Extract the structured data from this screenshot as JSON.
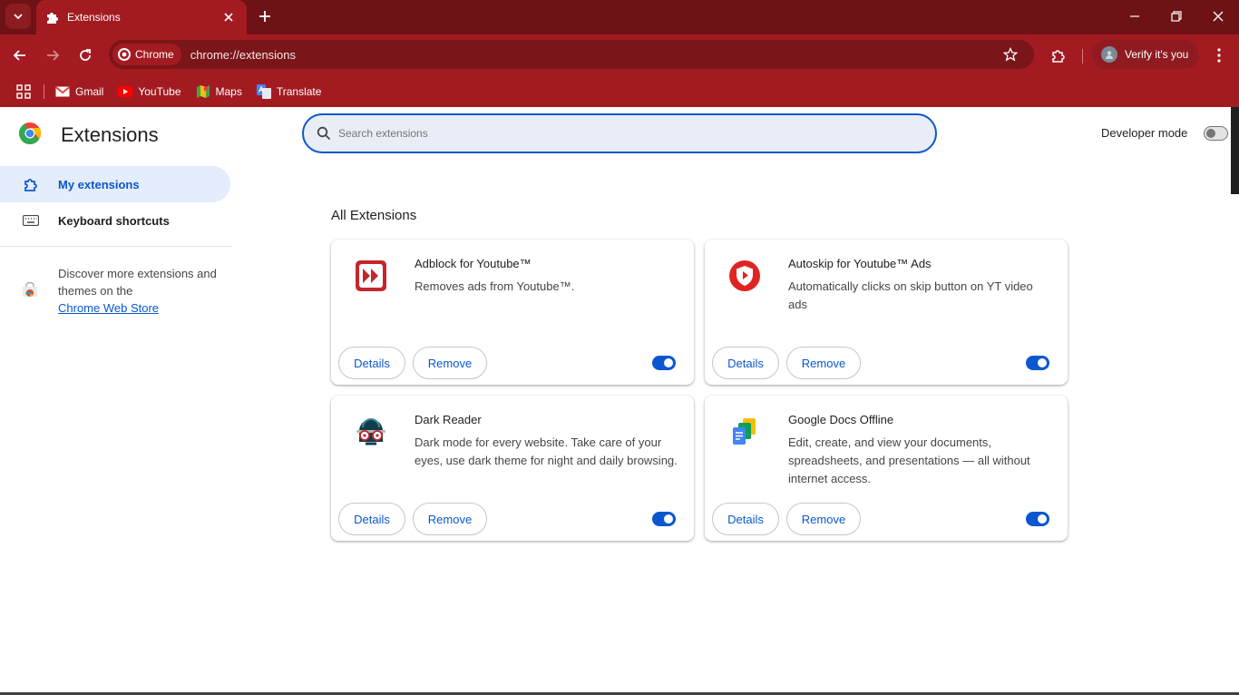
{
  "browser": {
    "tab": {
      "title": "Extensions"
    },
    "address": {
      "chip_label": "Chrome",
      "url": "chrome://extensions"
    },
    "profile": {
      "label": "Verify it's you"
    },
    "bookmarks": [
      {
        "label": "Gmail",
        "icon": "gmail-icon"
      },
      {
        "label": "YouTube",
        "icon": "youtube-icon"
      },
      {
        "label": "Maps",
        "icon": "maps-icon"
      },
      {
        "label": "Translate",
        "icon": "translate-icon"
      }
    ]
  },
  "page": {
    "title": "Extensions",
    "search": {
      "placeholder": "Search extensions",
      "value": ""
    },
    "developer_mode": {
      "label": "Developer mode",
      "enabled": false
    }
  },
  "sidebar": {
    "items": [
      {
        "label": "My extensions",
        "active": true,
        "icon": "puzzle-icon"
      },
      {
        "label": "Keyboard shortcuts",
        "active": false,
        "icon": "keyboard-icon"
      }
    ],
    "store": {
      "text": "Discover more extensions and themes on the",
      "link": "Chrome Web Store"
    }
  },
  "extensions": {
    "section_title": "All Extensions",
    "details_label": "Details",
    "remove_label": "Remove",
    "items": [
      {
        "name": "Adblock for Youtube™",
        "description": "Removes ads from Youtube™.",
        "enabled": true,
        "icon": "adblock-icon"
      },
      {
        "name": "Autoskip for Youtube™ Ads",
        "description": "Automatically clicks on skip button on YT video ads",
        "enabled": true,
        "icon": "autoskip-shield-icon"
      },
      {
        "name": "Dark Reader",
        "description": "Dark mode for every website. Take care of your eyes, use dark theme for night and daily browsing.",
        "enabled": true,
        "icon": "dark-reader-icon"
      },
      {
        "name": "Google Docs Offline",
        "description": "Edit, create, and view your documents, spreadsheets, and presentations — all without internet access.",
        "enabled": true,
        "icon": "google-docs-icon"
      }
    ]
  },
  "colors": {
    "frame": "#6e1216",
    "toolbar": "#a31b21",
    "accent": "#0b57d0"
  }
}
